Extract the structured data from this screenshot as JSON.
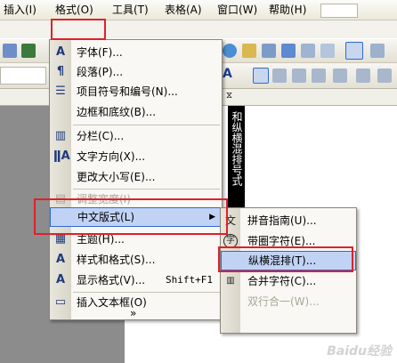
{
  "menubar": {
    "items": [
      "插入(I)",
      "格式(O)",
      "工具(T)",
      "表格(A)",
      "窗口(W)",
      "帮助(H)"
    ]
  },
  "document": {
    "vertical_text": "和纵横混排号式"
  },
  "format_menu": {
    "items": [
      {
        "icon": "A",
        "label": "字体(F)..."
      },
      {
        "icon": "¶",
        "label": "段落(P)..."
      },
      {
        "icon": "☰",
        "label": "项目符号和编号(N)..."
      },
      {
        "icon": "",
        "label": "边框和底纹(B)..."
      },
      {
        "icon": "▥",
        "label": "分栏(C)..."
      },
      {
        "icon": "ǁA",
        "label": "文字方向(X)..."
      },
      {
        "icon": "",
        "label": "更改大小写(E)..."
      },
      {
        "icon": "▤",
        "label": "调整宽度(I)"
      },
      {
        "icon": "",
        "label": "中文版式(L)"
      },
      {
        "icon": "▦",
        "label": "主题(H)..."
      },
      {
        "icon": "A",
        "label": "样式和格式(S)..."
      },
      {
        "icon": "A",
        "label": "显示格式(V)...",
        "shortcut": "Shift+F1"
      },
      {
        "icon": "▭",
        "label": "插入文本框(O)"
      }
    ],
    "expand_glyph": "»"
  },
  "chinese_layout_submenu": {
    "items": [
      {
        "icon": "文",
        "label": "拼音指南(U)..."
      },
      {
        "icon": "字",
        "label": "带圈字符(E)..."
      },
      {
        "icon": "",
        "label": "纵横混排(T)..."
      },
      {
        "icon": "",
        "label": "合并字符(C)..."
      },
      {
        "icon": "",
        "label": "双行合一(W)..."
      }
    ]
  },
  "watermark": "Baidu经验",
  "colors": {
    "highlight_bg": "#c1d3f5",
    "highlight_border": "#3168d5",
    "annotation_red": "#e0202a"
  }
}
